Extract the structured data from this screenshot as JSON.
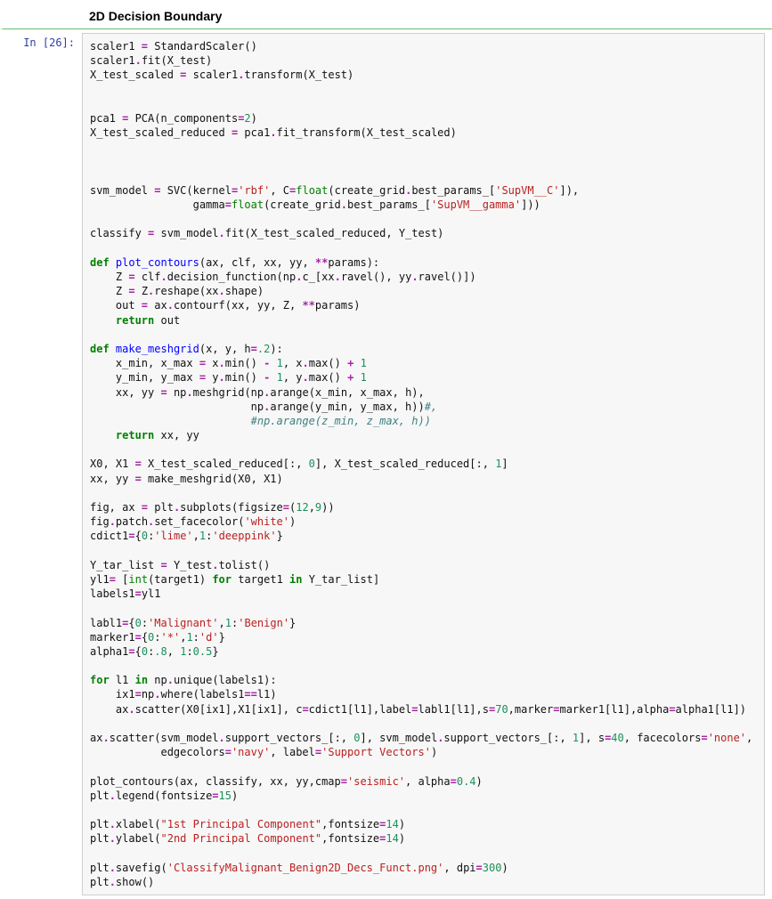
{
  "heading": "2D Decision Boundary",
  "prompt": {
    "label": "In",
    "number": "26"
  },
  "code_lines": [
    [
      [
        "scaler1 "
      ],
      [
        "=",
        "op"
      ],
      [
        " StandardScaler()"
      ]
    ],
    [
      [
        "scaler1"
      ],
      [
        ".",
        "op"
      ],
      [
        "fit(X_test)"
      ]
    ],
    [
      [
        "X_test_scaled "
      ],
      [
        "=",
        "op"
      ],
      [
        " scaler1"
      ],
      [
        ".",
        "op"
      ],
      [
        "transform(X_test)"
      ]
    ],
    [],
    [],
    [
      [
        "pca1 "
      ],
      [
        "=",
        "op"
      ],
      [
        " PCA(n_components"
      ],
      [
        "=",
        "op"
      ],
      [
        "2",
        "num"
      ],
      [
        ")"
      ]
    ],
    [
      [
        "X_test_scaled_reduced "
      ],
      [
        "=",
        "op"
      ],
      [
        " pca1"
      ],
      [
        ".",
        "op"
      ],
      [
        "fit_transform(X_test_scaled)"
      ]
    ],
    [],
    [],
    [],
    [
      [
        "svm_model "
      ],
      [
        "=",
        "op"
      ],
      [
        " SVC(kernel"
      ],
      [
        "=",
        "op"
      ],
      [
        "'rbf'",
        "str"
      ],
      [
        ", C"
      ],
      [
        "=",
        "op"
      ],
      [
        "float",
        "builtin"
      ],
      [
        "(create_grid"
      ],
      [
        ".",
        "op"
      ],
      [
        "best_params_["
      ],
      [
        "'SupVM__C'",
        "str"
      ],
      [
        "]),"
      ]
    ],
    [
      [
        "                gamma"
      ],
      [
        "=",
        "op"
      ],
      [
        "float",
        "builtin"
      ],
      [
        "(create_grid"
      ],
      [
        ".",
        "op"
      ],
      [
        "best_params_["
      ],
      [
        "'SupVM__gamma'",
        "str"
      ],
      [
        "]))"
      ]
    ],
    [],
    [
      [
        "classify "
      ],
      [
        "=",
        "op"
      ],
      [
        " svm_model"
      ],
      [
        ".",
        "op"
      ],
      [
        "fit(X_test_scaled_reduced, Y_test)"
      ]
    ],
    [],
    [
      [
        "def",
        "kw"
      ],
      [
        " "
      ],
      [
        "plot_contours",
        "fn"
      ],
      [
        "(ax, clf, xx, yy, "
      ],
      [
        "**",
        "op"
      ],
      [
        "params):"
      ]
    ],
    [
      [
        "    Z "
      ],
      [
        "=",
        "op"
      ],
      [
        " clf"
      ],
      [
        ".",
        "op"
      ],
      [
        "decision_function(np"
      ],
      [
        ".",
        "op"
      ],
      [
        "c_[xx"
      ],
      [
        ".",
        "op"
      ],
      [
        "ravel(), yy"
      ],
      [
        ".",
        "op"
      ],
      [
        "ravel()])"
      ]
    ],
    [
      [
        "    Z "
      ],
      [
        "=",
        "op"
      ],
      [
        " Z"
      ],
      [
        ".",
        "op"
      ],
      [
        "reshape(xx"
      ],
      [
        ".",
        "op"
      ],
      [
        "shape)"
      ]
    ],
    [
      [
        "    out "
      ],
      [
        "=",
        "op"
      ],
      [
        " ax"
      ],
      [
        ".",
        "op"
      ],
      [
        "contourf(xx, yy, Z, "
      ],
      [
        "**",
        "op"
      ],
      [
        "params)"
      ]
    ],
    [
      [
        "    "
      ],
      [
        "return",
        "kw"
      ],
      [
        " out"
      ]
    ],
    [],
    [
      [
        "def",
        "kw"
      ],
      [
        " "
      ],
      [
        "make_meshgrid",
        "fn"
      ],
      [
        "(x, y, h"
      ],
      [
        "=",
        "op"
      ],
      [
        ".2",
        "num"
      ],
      [
        "):"
      ]
    ],
    [
      [
        "    x_min, x_max "
      ],
      [
        "=",
        "op"
      ],
      [
        " x"
      ],
      [
        ".",
        "op"
      ],
      [
        "min() "
      ],
      [
        "-",
        "op"
      ],
      [
        " "
      ],
      [
        "1",
        "num"
      ],
      [
        ", x"
      ],
      [
        ".",
        "op"
      ],
      [
        "max() "
      ],
      [
        "+",
        "op"
      ],
      [
        " "
      ],
      [
        "1",
        "num"
      ]
    ],
    [
      [
        "    y_min, y_max "
      ],
      [
        "=",
        "op"
      ],
      [
        " y"
      ],
      [
        ".",
        "op"
      ],
      [
        "min() "
      ],
      [
        "-",
        "op"
      ],
      [
        " "
      ],
      [
        "1",
        "num"
      ],
      [
        ", y"
      ],
      [
        ".",
        "op"
      ],
      [
        "max() "
      ],
      [
        "+",
        "op"
      ],
      [
        " "
      ],
      [
        "1",
        "num"
      ]
    ],
    [
      [
        "    xx, yy "
      ],
      [
        "=",
        "op"
      ],
      [
        " np"
      ],
      [
        ".",
        "op"
      ],
      [
        "meshgrid(np"
      ],
      [
        ".",
        "op"
      ],
      [
        "arange(x_min, x_max, h),"
      ]
    ],
    [
      [
        "                         np"
      ],
      [
        ".",
        "op"
      ],
      [
        "arange(y_min, y_max, h))"
      ],
      [
        "#,",
        "cmt"
      ]
    ],
    [
      [
        "                         "
      ],
      [
        "#np.arange(z_min, z_max, h))",
        "cmt"
      ]
    ],
    [
      [
        "    "
      ],
      [
        "return",
        "kw"
      ],
      [
        " xx, yy"
      ]
    ],
    [],
    [
      [
        "X0, X1 "
      ],
      [
        "=",
        "op"
      ],
      [
        " X_test_scaled_reduced[:, "
      ],
      [
        "0",
        "num"
      ],
      [
        "], X_test_scaled_reduced[:, "
      ],
      [
        "1",
        "num"
      ],
      [
        "]"
      ]
    ],
    [
      [
        "xx, yy "
      ],
      [
        "=",
        "op"
      ],
      [
        " make_meshgrid(X0, X1)"
      ]
    ],
    [],
    [
      [
        "fig, ax "
      ],
      [
        "=",
        "op"
      ],
      [
        " plt"
      ],
      [
        ".",
        "op"
      ],
      [
        "subplots(figsize"
      ],
      [
        "=",
        "op"
      ],
      [
        "("
      ],
      [
        "12",
        "num"
      ],
      [
        ","
      ],
      [
        "9",
        "num"
      ],
      [
        "))"
      ]
    ],
    [
      [
        "fig"
      ],
      [
        ".",
        "op"
      ],
      [
        "patch"
      ],
      [
        ".",
        "op"
      ],
      [
        "set_facecolor("
      ],
      [
        "'white'",
        "str"
      ],
      [
        ")"
      ]
    ],
    [
      [
        "cdict1"
      ],
      [
        "=",
        "op"
      ],
      [
        "{"
      ],
      [
        "0",
        "num"
      ],
      [
        ":"
      ],
      [
        "'lime'",
        "str"
      ],
      [
        ","
      ],
      [
        "1",
        "num"
      ],
      [
        ":"
      ],
      [
        "'deeppink'",
        "str"
      ],
      [
        "}"
      ]
    ],
    [],
    [
      [
        "Y_tar_list "
      ],
      [
        "=",
        "op"
      ],
      [
        " Y_test"
      ],
      [
        ".",
        "op"
      ],
      [
        "tolist()"
      ]
    ],
    [
      [
        "yl1"
      ],
      [
        "=",
        "op"
      ],
      [
        " ["
      ],
      [
        "int",
        "builtin"
      ],
      [
        "(target1) "
      ],
      [
        "for",
        "kw"
      ],
      [
        " target1 "
      ],
      [
        "in",
        "kw"
      ],
      [
        " Y_tar_list]"
      ]
    ],
    [
      [
        "labels1"
      ],
      [
        "=",
        "op"
      ],
      [
        "yl1"
      ]
    ],
    [],
    [
      [
        "labl1"
      ],
      [
        "=",
        "op"
      ],
      [
        "{"
      ],
      [
        "0",
        "num"
      ],
      [
        ":"
      ],
      [
        "'Malignant'",
        "str"
      ],
      [
        ","
      ],
      [
        "1",
        "num"
      ],
      [
        ":"
      ],
      [
        "'Benign'",
        "str"
      ],
      [
        "}"
      ]
    ],
    [
      [
        "marker1"
      ],
      [
        "=",
        "op"
      ],
      [
        "{"
      ],
      [
        "0",
        "num"
      ],
      [
        ":"
      ],
      [
        "'*'",
        "str"
      ],
      [
        ","
      ],
      [
        "1",
        "num"
      ],
      [
        ":"
      ],
      [
        "'d'",
        "str"
      ],
      [
        "}"
      ]
    ],
    [
      [
        "alpha1"
      ],
      [
        "=",
        "op"
      ],
      [
        "{"
      ],
      [
        "0",
        "num"
      ],
      [
        ":"
      ],
      [
        ".8",
        "num"
      ],
      [
        ", "
      ],
      [
        "1",
        "num"
      ],
      [
        ":"
      ],
      [
        "0.5",
        "num"
      ],
      [
        "}"
      ]
    ],
    [],
    [
      [
        "for",
        "kw"
      ],
      [
        " l1 "
      ],
      [
        "in",
        "kw"
      ],
      [
        " np"
      ],
      [
        ".",
        "op"
      ],
      [
        "unique(labels1):"
      ]
    ],
    [
      [
        "    ix1"
      ],
      [
        "=",
        "op"
      ],
      [
        "np"
      ],
      [
        ".",
        "op"
      ],
      [
        "where(labels1"
      ],
      [
        "==",
        "op"
      ],
      [
        "l1)"
      ]
    ],
    [
      [
        "    ax"
      ],
      [
        ".",
        "op"
      ],
      [
        "scatter(X0[ix1],X1[ix1], c"
      ],
      [
        "=",
        "op"
      ],
      [
        "cdict1[l1],label"
      ],
      [
        "=",
        "op"
      ],
      [
        "labl1[l1],s"
      ],
      [
        "=",
        "op"
      ],
      [
        "70",
        "num"
      ],
      [
        ",marker"
      ],
      [
        "=",
        "op"
      ],
      [
        "marker1[l1],alpha"
      ],
      [
        "=",
        "op"
      ],
      [
        "alpha1[l1])"
      ]
    ],
    [],
    [
      [
        "ax"
      ],
      [
        ".",
        "op"
      ],
      [
        "scatter(svm_model"
      ],
      [
        ".",
        "op"
      ],
      [
        "support_vectors_[:, "
      ],
      [
        "0",
        "num"
      ],
      [
        "], svm_model"
      ],
      [
        ".",
        "op"
      ],
      [
        "support_vectors_[:, "
      ],
      [
        "1",
        "num"
      ],
      [
        "], s"
      ],
      [
        "=",
        "op"
      ],
      [
        "40",
        "num"
      ],
      [
        ", facecolors"
      ],
      [
        "=",
        "op"
      ],
      [
        "'none'",
        "str"
      ],
      [
        ","
      ]
    ],
    [
      [
        "           edgecolors"
      ],
      [
        "=",
        "op"
      ],
      [
        "'navy'",
        "str"
      ],
      [
        ", label"
      ],
      [
        "=",
        "op"
      ],
      [
        "'Support Vectors'",
        "str"
      ],
      [
        ")"
      ]
    ],
    [],
    [
      [
        "plot_contours(ax, classify, xx, yy,cmap"
      ],
      [
        "=",
        "op"
      ],
      [
        "'seismic'",
        "str"
      ],
      [
        ", alpha"
      ],
      [
        "=",
        "op"
      ],
      [
        "0.4",
        "num"
      ],
      [
        ")"
      ]
    ],
    [
      [
        "plt"
      ],
      [
        ".",
        "op"
      ],
      [
        "legend(fontsize"
      ],
      [
        "=",
        "op"
      ],
      [
        "15",
        "num"
      ],
      [
        ")"
      ]
    ],
    [],
    [
      [
        "plt"
      ],
      [
        ".",
        "op"
      ],
      [
        "xlabel("
      ],
      [
        "\"1st Principal Component\"",
        "str"
      ],
      [
        ",fontsize"
      ],
      [
        "=",
        "op"
      ],
      [
        "14",
        "num"
      ],
      [
        ")"
      ]
    ],
    [
      [
        "plt"
      ],
      [
        ".",
        "op"
      ],
      [
        "ylabel("
      ],
      [
        "\"2nd Principal Component\"",
        "str"
      ],
      [
        ",fontsize"
      ],
      [
        "=",
        "op"
      ],
      [
        "14",
        "num"
      ],
      [
        ")"
      ]
    ],
    [],
    [
      [
        "plt"
      ],
      [
        ".",
        "op"
      ],
      [
        "savefig("
      ],
      [
        "'ClassifyMalignant_Benign2D_Decs_Funct.png'",
        "str"
      ],
      [
        ", dpi"
      ],
      [
        "=",
        "op"
      ],
      [
        "300",
        "num"
      ],
      [
        ")"
      ]
    ],
    [
      [
        "plt"
      ],
      [
        ".",
        "op"
      ],
      [
        "show()"
      ]
    ]
  ]
}
